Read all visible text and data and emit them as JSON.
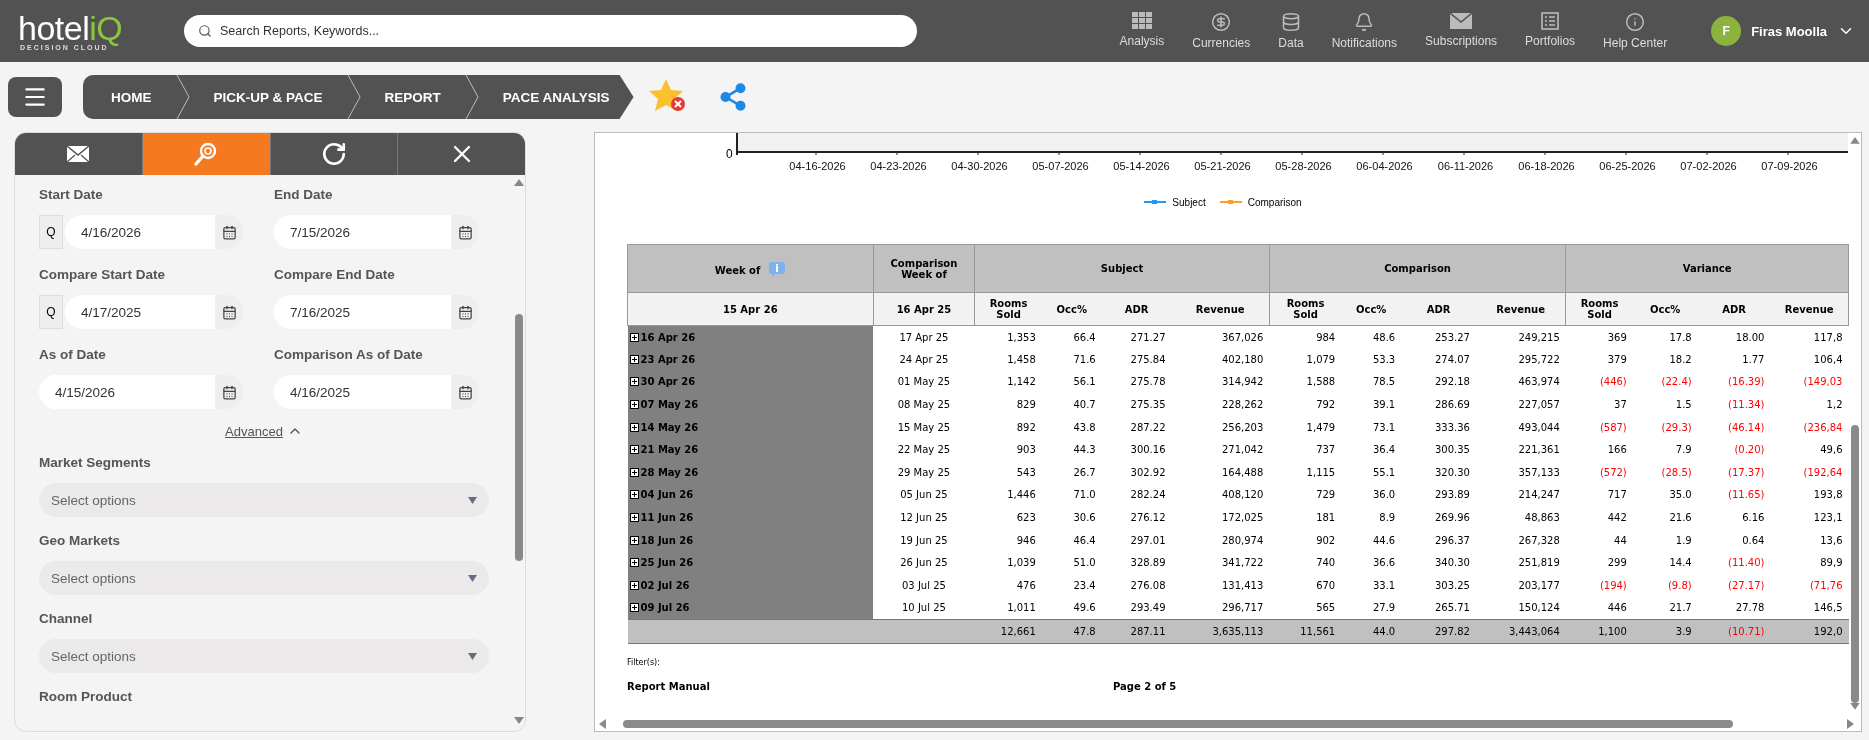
{
  "header": {
    "logo": {
      "main": "hotel",
      "accent": "iQ",
      "tagline": "DECISION CLOUD"
    },
    "search": {
      "placeholder": "Search Reports, Keywords..."
    },
    "nav": [
      {
        "kind": "grid",
        "label": "Analysis"
      },
      {
        "kind": "dollar",
        "label": "Currencies"
      },
      {
        "kind": "database",
        "label": "Data"
      },
      {
        "kind": "bell",
        "label": "Notifications"
      },
      {
        "kind": "mail",
        "label": "Subscriptions"
      },
      {
        "kind": "list",
        "label": "Portfolios"
      },
      {
        "kind": "info",
        "label": "Help Center"
      }
    ],
    "user": {
      "initial": "F",
      "name": "Firas Moolla"
    }
  },
  "breadcrumb": [
    "HOME",
    "PICK-UP & PACE",
    "REPORT",
    "PACE ANALYSIS"
  ],
  "panel": {
    "tabs": [
      {
        "kind": "mail",
        "selected": false
      },
      {
        "kind": "search",
        "selected": true
      },
      {
        "kind": "refresh",
        "selected": false
      },
      {
        "kind": "close",
        "selected": false
      }
    ],
    "date_fields": [
      {
        "label": "Start Date",
        "value": "4/16/2026",
        "quarter": "Q"
      },
      {
        "label": "End Date",
        "value": "7/15/2026"
      },
      {
        "label": "Compare Start Date",
        "value": "4/17/2025",
        "quarter": "Q"
      },
      {
        "label": "Compare End Date",
        "value": "7/16/2025"
      },
      {
        "label": "As of Date",
        "value": "4/15/2026"
      },
      {
        "label": "Comparison As of Date",
        "value": "4/16/2025"
      }
    ],
    "advanced": {
      "label": "Advanced",
      "expanded": true
    },
    "filters": [
      {
        "label": "Market Segments",
        "placeholder": "Select options"
      },
      {
        "label": "Geo Markets",
        "placeholder": "Select options"
      },
      {
        "label": "Channel",
        "placeholder": "Select options"
      },
      {
        "label": "Room Product"
      }
    ]
  },
  "report": {
    "chart": {
      "y_tick": "0",
      "x_ticks": [
        "04-16-2026",
        "04-23-2026",
        "04-30-2026",
        "05-07-2026",
        "05-14-2026",
        "05-21-2026",
        "05-28-2026",
        "06-04-2026",
        "06-11-2026",
        "06-18-2026",
        "06-25-2026",
        "07-02-2026",
        "07-09-2026"
      ],
      "legend": [
        {
          "name": "Subject",
          "color": "#2196f3"
        },
        {
          "name": "Comparison",
          "color": "#ff9d2e"
        }
      ]
    },
    "table": {
      "week_header": "Week of",
      "comparison_week_header": "Comparison Week of",
      "week_sub": "15 Apr 26",
      "comparison_week_sub": "16 Apr 25",
      "groups": [
        {
          "title": "Subject",
          "columns": [
            "Rooms Sold",
            "Occ%",
            "ADR",
            "Revenue"
          ]
        },
        {
          "title": "Comparison",
          "columns": [
            "Rooms Sold",
            "Occ%",
            "ADR",
            "Revenue"
          ]
        },
        {
          "title": "Variance",
          "columns": [
            "Rooms Sold",
            "Occ%",
            "ADR",
            "Revenue"
          ]
        }
      ],
      "rows": [
        {
          "week": "16 Apr 26",
          "comparison_week": "17 Apr 25",
          "subject": [
            "1,353",
            "66.4",
            "271.27",
            "367,026"
          ],
          "comparison": [
            "984",
            "48.6",
            "253.27",
            "249,215"
          ],
          "variance": [
            {
              "value": "369",
              "negative": false
            },
            {
              "value": "17.8",
              "negative": false
            },
            {
              "value": "18.00",
              "negative": false
            },
            {
              "value": "117,8",
              "negative": false
            }
          ]
        },
        {
          "week": "23 Apr 26",
          "comparison_week": "24 Apr 25",
          "subject": [
            "1,458",
            "71.6",
            "275.84",
            "402,180"
          ],
          "comparison": [
            "1,079",
            "53.3",
            "274.07",
            "295,722"
          ],
          "variance": [
            {
              "value": "379",
              "negative": false
            },
            {
              "value": "18.2",
              "negative": false
            },
            {
              "value": "1.77",
              "negative": false
            },
            {
              "value": "106,4",
              "negative": false
            }
          ]
        },
        {
          "week": "30 Apr 26",
          "comparison_week": "01 May 25",
          "subject": [
            "1,142",
            "56.1",
            "275.78",
            "314,942"
          ],
          "comparison": [
            "1,588",
            "78.5",
            "292.18",
            "463,974"
          ],
          "variance": [
            {
              "value": "(446)",
              "negative": true
            },
            {
              "value": "(22.4)",
              "negative": true
            },
            {
              "value": "(16.39)",
              "negative": true
            },
            {
              "value": "(149,03",
              "negative": true
            }
          ]
        },
        {
          "week": "07 May 26",
          "comparison_week": "08 May 25",
          "subject": [
            "829",
            "40.7",
            "275.35",
            "228,262"
          ],
          "comparison": [
            "792",
            "39.1",
            "286.69",
            "227,057"
          ],
          "variance": [
            {
              "value": "37",
              "negative": false
            },
            {
              "value": "1.5",
              "negative": false
            },
            {
              "value": "(11.34)",
              "negative": true
            },
            {
              "value": "1,2",
              "negative": false
            }
          ]
        },
        {
          "week": "14 May 26",
          "comparison_week": "15 May 25",
          "subject": [
            "892",
            "43.8",
            "287.22",
            "256,203"
          ],
          "comparison": [
            "1,479",
            "73.1",
            "333.36",
            "493,044"
          ],
          "variance": [
            {
              "value": "(587)",
              "negative": true
            },
            {
              "value": "(29.3)",
              "negative": true
            },
            {
              "value": "(46.14)",
              "negative": true
            },
            {
              "value": "(236,84",
              "negative": true
            }
          ]
        },
        {
          "week": "21 May 26",
          "comparison_week": "22 May 25",
          "subject": [
            "903",
            "44.3",
            "300.16",
            "271,042"
          ],
          "comparison": [
            "737",
            "36.4",
            "300.35",
            "221,361"
          ],
          "variance": [
            {
              "value": "166",
              "negative": false
            },
            {
              "value": "7.9",
              "negative": false
            },
            {
              "value": "(0.20)",
              "negative": true
            },
            {
              "value": "49,6",
              "negative": false
            }
          ]
        },
        {
          "week": "28 May 26",
          "comparison_week": "29 May 25",
          "subject": [
            "543",
            "26.7",
            "302.92",
            "164,488"
          ],
          "comparison": [
            "1,115",
            "55.1",
            "320.30",
            "357,133"
          ],
          "variance": [
            {
              "value": "(572)",
              "negative": true
            },
            {
              "value": "(28.5)",
              "negative": true
            },
            {
              "value": "(17.37)",
              "negative": true
            },
            {
              "value": "(192,64",
              "negative": true
            }
          ]
        },
        {
          "week": "04 Jun 26",
          "comparison_week": "05 Jun 25",
          "subject": [
            "1,446",
            "71.0",
            "282.24",
            "408,120"
          ],
          "comparison": [
            "729",
            "36.0",
            "293.89",
            "214,247"
          ],
          "variance": [
            {
              "value": "717",
              "negative": false
            },
            {
              "value": "35.0",
              "negative": false
            },
            {
              "value": "(11.65)",
              "negative": true
            },
            {
              "value": "193,8",
              "negative": false
            }
          ]
        },
        {
          "week": "11 Jun 26",
          "comparison_week": "12 Jun 25",
          "subject": [
            "623",
            "30.6",
            "276.12",
            "172,025"
          ],
          "comparison": [
            "181",
            "8.9",
            "269.96",
            "48,863"
          ],
          "variance": [
            {
              "value": "442",
              "negative": false
            },
            {
              "value": "21.6",
              "negative": false
            },
            {
              "value": "6.16",
              "negative": false
            },
            {
              "value": "123,1",
              "negative": false
            }
          ]
        },
        {
          "week": "18 Jun 26",
          "comparison_week": "19 Jun 25",
          "subject": [
            "946",
            "46.4",
            "297.01",
            "280,974"
          ],
          "comparison": [
            "902",
            "44.6",
            "296.37",
            "267,328"
          ],
          "variance": [
            {
              "value": "44",
              "negative": false
            },
            {
              "value": "1.9",
              "negative": false
            },
            {
              "value": "0.64",
              "negative": false
            },
            {
              "value": "13,6",
              "negative": false
            }
          ]
        },
        {
          "week": "25 Jun 26",
          "comparison_week": "26 Jun 25",
          "subject": [
            "1,039",
            "51.0",
            "328.89",
            "341,722"
          ],
          "comparison": [
            "740",
            "36.6",
            "340.30",
            "251,819"
          ],
          "variance": [
            {
              "value": "299",
              "negative": false
            },
            {
              "value": "14.4",
              "negative": false
            },
            {
              "value": "(11.40)",
              "negative": true
            },
            {
              "value": "89,9",
              "negative": false
            }
          ]
        },
        {
          "week": "02 Jul 26",
          "comparison_week": "03 Jul 25",
          "subject": [
            "476",
            "23.4",
            "276.08",
            "131,413"
          ],
          "comparison": [
            "670",
            "33.1",
            "303.25",
            "203,177"
          ],
          "variance": [
            {
              "value": "(194)",
              "negative": true
            },
            {
              "value": "(9.8)",
              "negative": true
            },
            {
              "value": "(27.17)",
              "negative": true
            },
            {
              "value": "(71,76",
              "negative": true
            }
          ]
        },
        {
          "week": "09 Jul 26",
          "comparison_week": "10 Jul 25",
          "subject": [
            "1,011",
            "49.6",
            "293.49",
            "296,717"
          ],
          "comparison": [
            "565",
            "27.9",
            "265.71",
            "150,124"
          ],
          "variance": [
            {
              "value": "446",
              "negative": false
            },
            {
              "value": "21.7",
              "negative": false
            },
            {
              "value": "27.78",
              "negative": false
            },
            {
              "value": "146,5",
              "negative": false
            }
          ]
        }
      ],
      "total": {
        "subject": [
          "12,661",
          "47.8",
          "287.11",
          "3,635,113"
        ],
        "comparison": [
          "11,561",
          "44.0",
          "297.82",
          "3,443,064"
        ],
        "variance": [
          {
            "value": "1,100",
            "negative": false
          },
          {
            "value": "3.9",
            "negative": false
          },
          {
            "value": "(10.71)",
            "negative": true
          },
          {
            "value": "192,0",
            "negative": false
          }
        ]
      }
    },
    "filters_label": "Filter(s):",
    "manual": "Report Manual",
    "page": "Page 2 of 5"
  }
}
